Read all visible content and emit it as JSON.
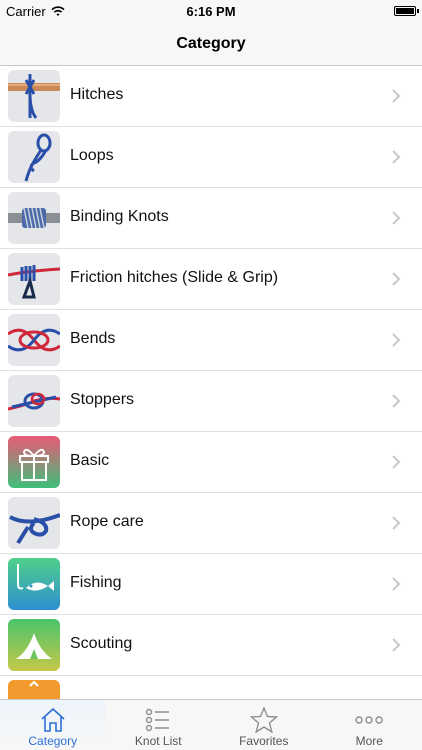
{
  "status": {
    "carrier": "Carrier",
    "time": "6:16 PM"
  },
  "nav": {
    "title": "Category"
  },
  "categories": [
    {
      "label": "Hitches"
    },
    {
      "label": "Loops"
    },
    {
      "label": "Binding Knots"
    },
    {
      "label": "Friction hitches (Slide & Grip)"
    },
    {
      "label": "Bends"
    },
    {
      "label": "Stoppers"
    },
    {
      "label": "Basic"
    },
    {
      "label": "Rope care"
    },
    {
      "label": "Fishing"
    },
    {
      "label": "Scouting"
    }
  ],
  "tabs": [
    {
      "label": "Category",
      "icon": "home-icon",
      "active": true
    },
    {
      "label": "Knot List",
      "icon": "list-icon",
      "active": false
    },
    {
      "label": "Favorites",
      "icon": "star-icon",
      "active": false
    },
    {
      "label": "More",
      "icon": "more-icon",
      "active": false
    }
  ],
  "colors": {
    "accent": "#2f6fd6",
    "separator": "#e0e0e0",
    "bar_bg": "#f7f7f7"
  }
}
